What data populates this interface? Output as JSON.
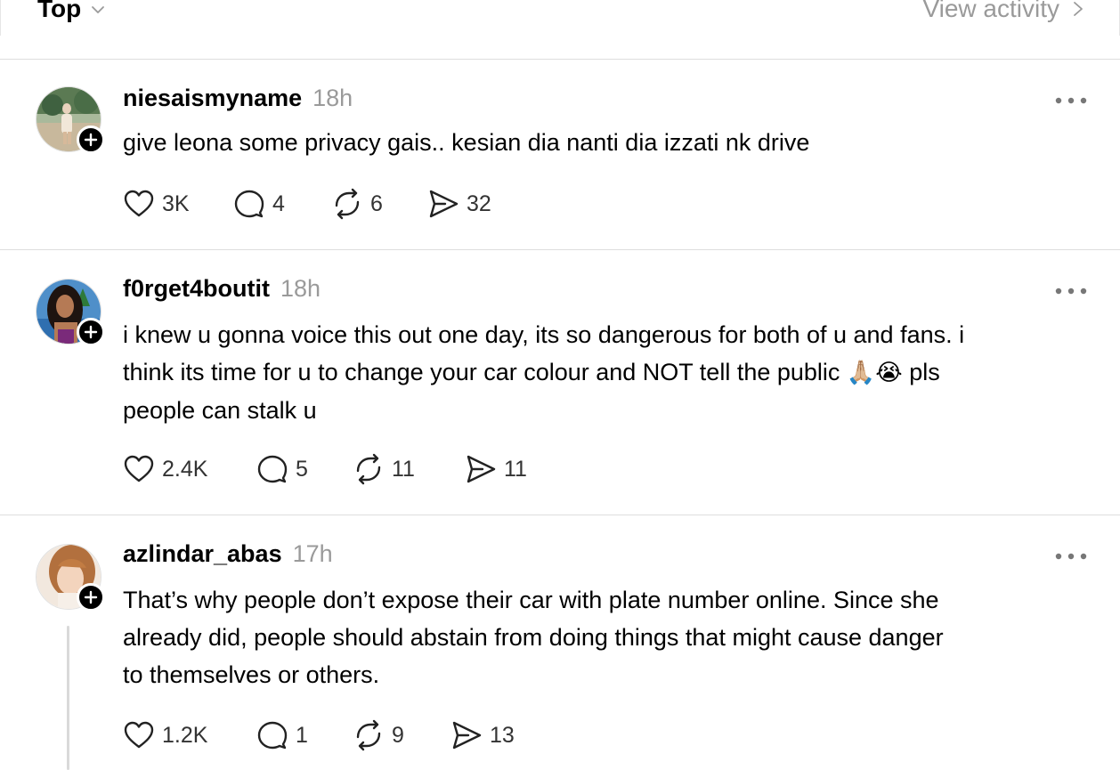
{
  "header": {
    "sort_label": "Top",
    "activity_label": "View activity"
  },
  "posts": [
    {
      "username": "niesaismyname",
      "time": "18h",
      "text": "give leona some privacy gais.. kesian dia nanti dia izzati nk drive",
      "likes": "3K",
      "replies": "4",
      "reposts": "6",
      "shares": "32"
    },
    {
      "username": "f0rget4boutit",
      "time": "18h",
      "text_lines": [
        "i knew u gonna voice this out one day, its so dangerous for both of u and fans. i",
        "think its time for u to change your car colour and NOT tell the public",
        "pls",
        "people can stalk u"
      ],
      "emojis": "🙏🏼😭",
      "likes": "2.4K",
      "replies": "5",
      "reposts": "11",
      "shares": "11"
    },
    {
      "username": "azlindar_abas",
      "time": "17h",
      "text_lines": [
        "That’s why people don’t expose their car with plate number online. Since she",
        "already did, people should abstain from doing things that might cause danger",
        "to themselves or others."
      ],
      "likes": "1.2K",
      "replies": "1",
      "reposts": "9",
      "shares": "13"
    }
  ],
  "icons": {
    "sort": "chevron-down-icon",
    "activity": "chevron-right-icon",
    "like": "heart-icon",
    "reply": "comment-icon",
    "repost": "repost-icon",
    "share": "send-icon",
    "more": "more-dots-icon",
    "follow": "plus-icon"
  },
  "colors": {
    "text": "#000000",
    "muted": "#9a9a9a",
    "divider": "#dedede",
    "badge": "#000000"
  }
}
